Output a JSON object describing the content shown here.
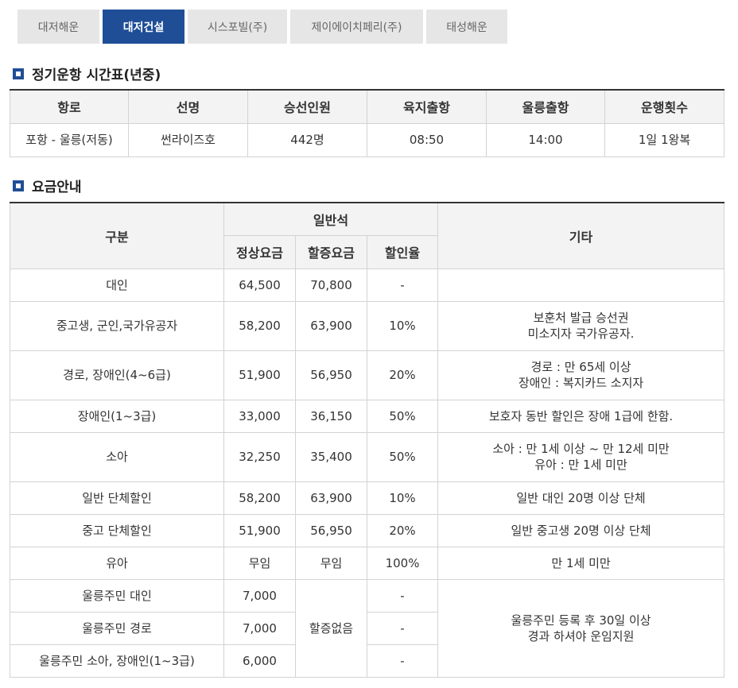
{
  "tabs": [
    {
      "label": "대저해운",
      "active": false
    },
    {
      "label": "대저건설",
      "active": true
    },
    {
      "label": "시스포빌(주)",
      "active": false
    },
    {
      "label": "제이에이치페리(주)",
      "active": false
    },
    {
      "label": "태성해운",
      "active": false
    }
  ],
  "schedule": {
    "title": "정기운항 시간표(년중)",
    "headers": [
      "항로",
      "선명",
      "승선인원",
      "육지출항",
      "울릉출항",
      "운행횟수"
    ],
    "row": [
      "포항 - 울릉(저동)",
      "썬라이즈호",
      "442명",
      "08:50",
      "14:00",
      "1일 1왕복"
    ]
  },
  "fares": {
    "title": "요금안내",
    "headers": {
      "category": "구분",
      "general_seat": "일반석",
      "normal_fare": "정상요금",
      "surcharge_fare": "할증요금",
      "discount_rate": "할인율",
      "other": "기타"
    },
    "rows": [
      {
        "category": "대인",
        "normal": "64,500",
        "surcharge": "70,800",
        "rate": "-",
        "note": ""
      },
      {
        "category": "중고생, 군인,국가유공자",
        "normal": "58,200",
        "surcharge": "63,900",
        "rate": "10%",
        "note": "보훈처 발급 승선권\n미소지자 국가유공자."
      },
      {
        "category": "경로, 장애인(4~6급)",
        "normal": "51,900",
        "surcharge": "56,950",
        "rate": "20%",
        "note": "경로 : 만 65세 이상\n장애인 : 복지카드 소지자"
      },
      {
        "category": "장애인(1~3급)",
        "normal": "33,000",
        "surcharge": "36,150",
        "rate": "50%",
        "note": "보호자 동반 할인은 장애 1급에 한함."
      },
      {
        "category": "소아",
        "normal": "32,250",
        "surcharge": "35,400",
        "rate": "50%",
        "note": "소아 : 만 1세 이상 ~ 만 12세 미만\n유아 : 만 1세 미만"
      },
      {
        "category": "일반 단체할인",
        "normal": "58,200",
        "surcharge": "63,900",
        "rate": "10%",
        "note": "일반 대인 20명 이상 단체"
      },
      {
        "category": "중고 단체할인",
        "normal": "51,900",
        "surcharge": "56,950",
        "rate": "20%",
        "note": "일반 중고생 20명 이상 단체"
      },
      {
        "category": "유아",
        "normal": "무임",
        "surcharge": "무임",
        "rate": "100%",
        "note": "만 1세 미만"
      }
    ],
    "resident_rows": [
      {
        "category": "울릉주민 대인",
        "normal": "7,000",
        "rate": "-"
      },
      {
        "category": "울릉주민 경로",
        "normal": "7,000",
        "rate": "-"
      },
      {
        "category": "울릉주민 소아, 장애인(1~3급)",
        "normal": "6,000",
        "rate": "-"
      }
    ],
    "resident_surcharge": "할증없음",
    "resident_note": "울릉주민 등록 후 30일 이상\n경과 하셔야 운임지원"
  }
}
